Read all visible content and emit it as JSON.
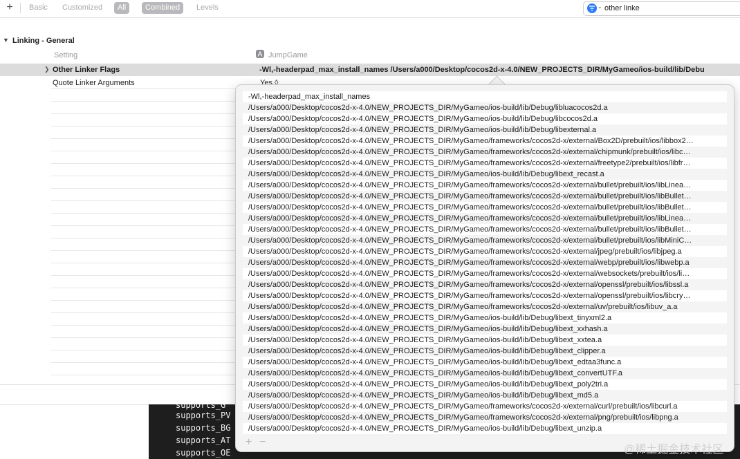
{
  "toolbar": {
    "add_label": "+",
    "segments": [
      "Basic",
      "Customized",
      "All",
      "Combined",
      "Levels"
    ],
    "active_segments": [
      "All",
      "Combined"
    ],
    "search_value": "other linke"
  },
  "section": {
    "disclosure": "❯",
    "title": "Linking - General"
  },
  "columns": {
    "setting": "Setting",
    "target": "JumpGame"
  },
  "rows": [
    {
      "name": "Other Linker Flags",
      "value": "-Wl,-headerpad_max_install_names /Users/a000/Desktop/cocos2d-x-4.0/NEW_PROJECTS_DIR/MyGameo/ios-build/lib/Debu",
      "selected": true
    },
    {
      "name": "Quote Linker Arguments",
      "value": "Yes ◊",
      "selected": false
    }
  ],
  "popover": {
    "items": [
      "-Wl,-headerpad_max_install_names",
      "/Users/a000/Desktop/cocos2d-x-4.0/NEW_PROJECTS_DIR/MyGameo/ios-build/lib/Debug/libluacocos2d.a",
      "/Users/a000/Desktop/cocos2d-x-4.0/NEW_PROJECTS_DIR/MyGameo/ios-build/lib/Debug/libcocos2d.a",
      "/Users/a000/Desktop/cocos2d-x-4.0/NEW_PROJECTS_DIR/MyGameo/ios-build/lib/Debug/libexternal.a",
      "/Users/a000/Desktop/cocos2d-x-4.0/NEW_PROJECTS_DIR/MyGameo/frameworks/cocos2d-x/external/Box2D/prebuilt/ios/libbox2…",
      "/Users/a000/Desktop/cocos2d-x-4.0/NEW_PROJECTS_DIR/MyGameo/frameworks/cocos2d-x/external/chipmunk/prebuilt/ios/libc…",
      "/Users/a000/Desktop/cocos2d-x-4.0/NEW_PROJECTS_DIR/MyGameo/frameworks/cocos2d-x/external/freetype2/prebuilt/ios/libfr…",
      "/Users/a000/Desktop/cocos2d-x-4.0/NEW_PROJECTS_DIR/MyGameo/ios-build/lib/Debug/libext_recast.a",
      "/Users/a000/Desktop/cocos2d-x-4.0/NEW_PROJECTS_DIR/MyGameo/frameworks/cocos2d-x/external/bullet/prebuilt/ios/libLinea…",
      "/Users/a000/Desktop/cocos2d-x-4.0/NEW_PROJECTS_DIR/MyGameo/frameworks/cocos2d-x/external/bullet/prebuilt/ios/libBullet…",
      "/Users/a000/Desktop/cocos2d-x-4.0/NEW_PROJECTS_DIR/MyGameo/frameworks/cocos2d-x/external/bullet/prebuilt/ios/libBullet…",
      "/Users/a000/Desktop/cocos2d-x-4.0/NEW_PROJECTS_DIR/MyGameo/frameworks/cocos2d-x/external/bullet/prebuilt/ios/libLinea…",
      "/Users/a000/Desktop/cocos2d-x-4.0/NEW_PROJECTS_DIR/MyGameo/frameworks/cocos2d-x/external/bullet/prebuilt/ios/libBullet…",
      "/Users/a000/Desktop/cocos2d-x-4.0/NEW_PROJECTS_DIR/MyGameo/frameworks/cocos2d-x/external/bullet/prebuilt/ios/libMiniC…",
      "/Users/a000/Desktop/cocos2d-x-4.0/NEW_PROJECTS_DIR/MyGameo/frameworks/cocos2d-x/external/jpeg/prebuilt/ios/libjpeg.a",
      "/Users/a000/Desktop/cocos2d-x-4.0/NEW_PROJECTS_DIR/MyGameo/frameworks/cocos2d-x/external/webp/prebuilt/ios/libwebp.a",
      "/Users/a000/Desktop/cocos2d-x-4.0/NEW_PROJECTS_DIR/MyGameo/frameworks/cocos2d-x/external/websockets/prebuilt/ios/li…",
      "/Users/a000/Desktop/cocos2d-x-4.0/NEW_PROJECTS_DIR/MyGameo/frameworks/cocos2d-x/external/openssl/prebuilt/ios/libssl.a",
      "/Users/a000/Desktop/cocos2d-x-4.0/NEW_PROJECTS_DIR/MyGameo/frameworks/cocos2d-x/external/openssl/prebuilt/ios/libcry…",
      "/Users/a000/Desktop/cocos2d-x-4.0/NEW_PROJECTS_DIR/MyGameo/frameworks/cocos2d-x/external/uv/prebuilt/ios/libuv_a.a",
      "/Users/a000/Desktop/cocos2d-x-4.0/NEW_PROJECTS_DIR/MyGameo/ios-build/lib/Debug/libext_tinyxml2.a",
      "/Users/a000/Desktop/cocos2d-x-4.0/NEW_PROJECTS_DIR/MyGameo/ios-build/lib/Debug/libext_xxhash.a",
      "/Users/a000/Desktop/cocos2d-x-4.0/NEW_PROJECTS_DIR/MyGameo/ios-build/lib/Debug/libext_xxtea.a",
      "/Users/a000/Desktop/cocos2d-x-4.0/NEW_PROJECTS_DIR/MyGameo/ios-build/lib/Debug/libext_clipper.a",
      "/Users/a000/Desktop/cocos2d-x-4.0/NEW_PROJECTS_DIR/MyGameo/ios-build/lib/Debug/libext_edtaa3func.a",
      "/Users/a000/Desktop/cocos2d-x-4.0/NEW_PROJECTS_DIR/MyGameo/ios-build/lib/Debug/libext_convertUTF.a",
      "/Users/a000/Desktop/cocos2d-x-4.0/NEW_PROJECTS_DIR/MyGameo/ios-build/lib/Debug/libext_poly2tri.a",
      "/Users/a000/Desktop/cocos2d-x-4.0/NEW_PROJECTS_DIR/MyGameo/ios-build/lib/Debug/libext_md5.a",
      "/Users/a000/Desktop/cocos2d-x-4.0/NEW_PROJECTS_DIR/MyGameo/frameworks/cocos2d-x/external/curl/prebuilt/ios/libcurl.a",
      "/Users/a000/Desktop/cocos2d-x-4.0/NEW_PROJECTS_DIR/MyGameo/frameworks/cocos2d-x/external/png/prebuilt/ios/libpng.a",
      "/Users/a000/Desktop/cocos2d-x-4.0/NEW_PROJECTS_DIR/MyGameo/ios-build/lib/Debug/libext_unzip.a"
    ],
    "add_label": "+",
    "remove_label": "−"
  },
  "terminal": {
    "lines": [
      "supports_G",
      "supports_PV",
      "supports_BG",
      "supports_AT",
      "supports_OE"
    ]
  },
  "watermark": "@稀土掘金技术社区"
}
